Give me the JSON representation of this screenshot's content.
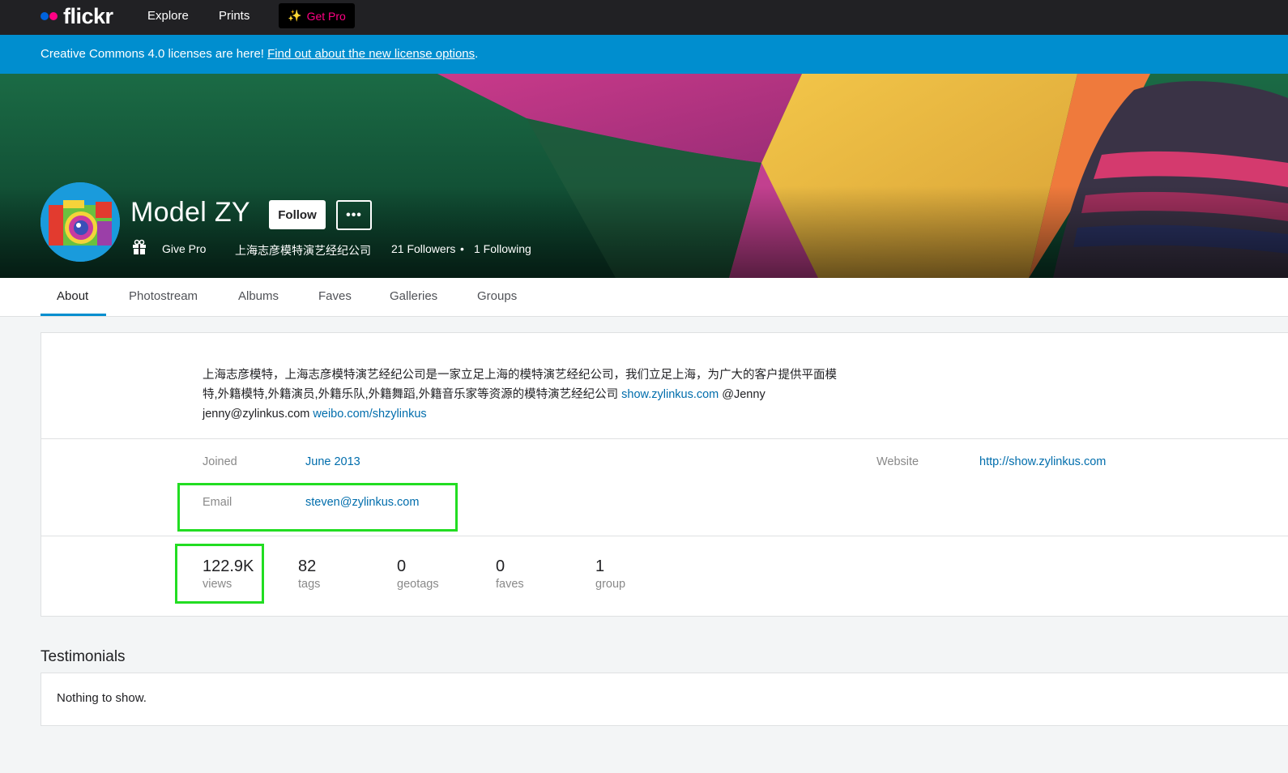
{
  "nav": {
    "logo_text": "flickr",
    "explore": "Explore",
    "prints": "Prints",
    "get_pro": "Get Pro"
  },
  "banner": {
    "text": "Creative Commons 4.0 licenses are here! ",
    "link": "Find out about the new license options",
    "suffix": "."
  },
  "profile": {
    "name": "Model ZY",
    "follow_label": "Follow",
    "more_label": "•••",
    "give_pro": "Give Pro",
    "company": "上海志彦模特演艺经纪公司",
    "followers": "21 Followers",
    "separator": "•",
    "following": "1 Following"
  },
  "tabs": [
    "About",
    "Photostream",
    "Albums",
    "Faves",
    "Galleries",
    "Groups"
  ],
  "about": {
    "description_line1": "上海志彦模特，上海志彦模特演艺经纪公司是一家立足上海的模特演艺经纪公司，我们立足上海，为广大的客户提供平面模",
    "description_line2_text": "特,外籍模特,外籍演员,外籍乐队,外籍舞蹈,外籍音乐家等资源的模特演艺经纪公司 ",
    "description_line2_link": "show.zylinkus.com",
    "description_line2_suffix": " @Jenny",
    "description_line3_text": "jenny@zylinkus.com ",
    "description_line3_link": "weibo.com/shzylinkus",
    "joined_label": "Joined",
    "joined_value": "June 2013",
    "website_label": "Website",
    "website_value": "http://show.zylinkus.com",
    "email_label": "Email",
    "email_value": "steven@zylinkus.com"
  },
  "stats": [
    {
      "num": "122.9K",
      "label": "views"
    },
    {
      "num": "82",
      "label": "tags"
    },
    {
      "num": "0",
      "label": "geotags"
    },
    {
      "num": "0",
      "label": "faves"
    },
    {
      "num": "1",
      "label": "group"
    }
  ],
  "testimonials": {
    "title": "Testimonials",
    "empty": "Nothing to show."
  },
  "colors": {
    "brand_blue": "#0063dc",
    "brand_pink": "#ff0084",
    "banner_blue": "#008ecf",
    "link_blue": "#006dac",
    "highlight_green": "#22dd22"
  }
}
